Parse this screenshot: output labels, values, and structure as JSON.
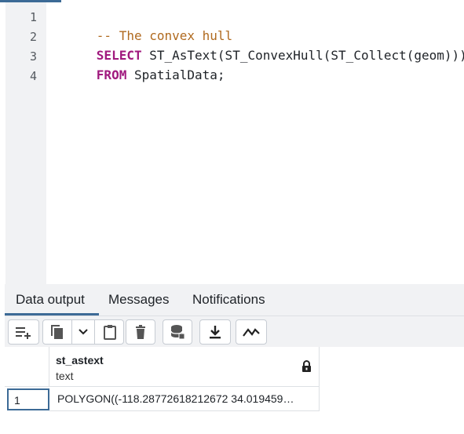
{
  "editor": {
    "line_numbers": [
      "1",
      "2",
      "3",
      "4"
    ],
    "line1": {
      "comment": "-- The convex hull"
    },
    "line2": {
      "keyword": "SELECT",
      "rest": " ST_AsText(ST_ConvexHull(ST_Collect(geom)))"
    },
    "line3": {
      "keyword": "FROM",
      "rest": " SpatialData;"
    },
    "line4": ""
  },
  "tabs": {
    "data_output": "Data output",
    "messages": "Messages",
    "notifications": "Notifications",
    "active": "data_output"
  },
  "toolbar": {
    "icons": [
      "add-row-icon",
      "copy-icon",
      "chevron-down-icon",
      "paste-icon",
      "delete-icon",
      "save-data-icon",
      "download-icon",
      "graph-icon"
    ]
  },
  "grid": {
    "columns": [
      {
        "name": "st_astext",
        "type": "text",
        "locked": true
      }
    ],
    "rows": [
      {
        "row_number": "1",
        "values": [
          "POLYGON((-118.28772618212672 34.019459…"
        ]
      }
    ]
  },
  "colors": {
    "accent": "#3c6a96",
    "keyword": "#a0197e",
    "comment": "#b06a1f",
    "panel_bg": "#f1f2f4"
  }
}
